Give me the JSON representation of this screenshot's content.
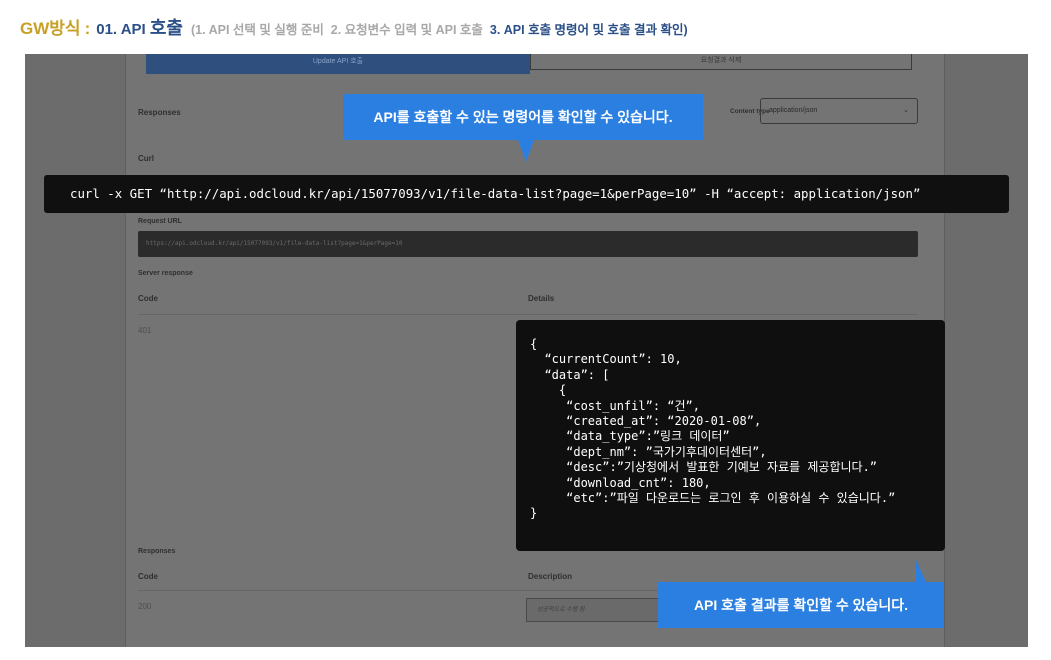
{
  "header": {
    "brand": "GW방식",
    "colon": ":",
    "step_num": "01. API",
    "step_word": "호출",
    "sub_open": "(1. API 선택 및 실행 준비",
    "sub_mid": "2. 요청변수 입력 및 API 호출",
    "sub_active": "3. API 호출 명령어 및 호출 결과 확인",
    "sub_close": ")"
  },
  "panel": {
    "btn_left": "Update API 호출",
    "btn_right": "요청결과 삭제",
    "responses_label": "Responses",
    "content_type_label": "Content type",
    "content_type_value": "application/json",
    "curl_label": "Curl",
    "request_url_label": "Request URL",
    "request_url": "https://api.odcloud.kr/api/15077093/v1/file-data-list?page=1&perPage=10",
    "server_response_label": "Server response",
    "code_header": "Code",
    "details_header": "Details",
    "code_401": "401",
    "responses_label2": "Responses",
    "code_header2": "Code",
    "description_header": "Description",
    "code_200": "200",
    "success_text": "성공적으로 수행 됨"
  },
  "curl_command": "curl -x GET “http://api.odcloud.kr/api/15077093/v1/file-data-list?page=1&perPage=10” -H “accept: application/json”",
  "tooltips": {
    "command": "API를 호출할 수 있는 명령어를 확인할 수 있습니다.",
    "result": "API  호출 결과를 확인할 수 있습니다."
  },
  "json_lines": [
    "{",
    "  “currentCount”: 10,",
    "  “data”: [",
    "    {",
    "     “cost_unfil”: “건”,",
    "     “created_at”: “2020-01-08”,",
    "     “data_type”:”링크 데이터”",
    "     “dept_nm”: ”국가기후데이터센터”,",
    "     “desc”:”기상청에서 발표한 기예보 자료를 제공합니다.”",
    "     “download_cnt”: 180,",
    "     “etc”:”파일 다운로드는 로그인 후 이용하실 수 있습니다.”",
    "}"
  ],
  "colors": {
    "brand": "#c8a028",
    "step": "#2b4f87",
    "tooltip": "#2b7fe0"
  }
}
